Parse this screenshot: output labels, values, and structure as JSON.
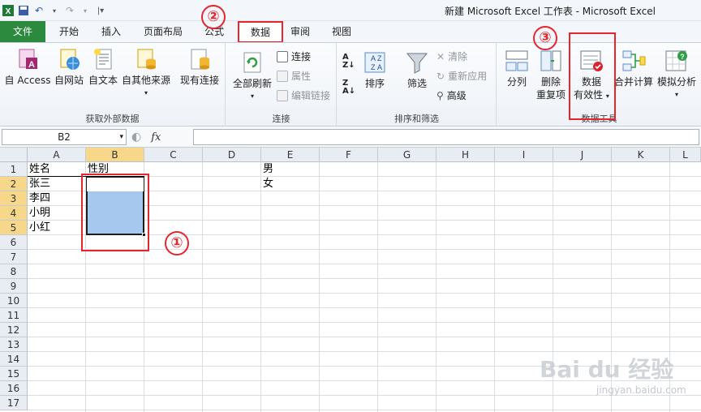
{
  "window": {
    "title": "新建 Microsoft Excel 工作表 - Microsoft Excel"
  },
  "tabs": [
    {
      "label": "文件"
    },
    {
      "label": "开始"
    },
    {
      "label": "插入"
    },
    {
      "label": "页面布局"
    },
    {
      "label": "公式"
    },
    {
      "label": "数据"
    },
    {
      "label": "审阅"
    },
    {
      "label": "视图"
    }
  ],
  "ribbon": {
    "external": {
      "label": "获取外部数据",
      "access": "自 Access",
      "web": "自网站",
      "text": "自文本",
      "other_top": "自其他来源",
      "existing": "现有连接"
    },
    "connections": {
      "label": "连接",
      "refresh_all": "全部刷新",
      "connections": "连接",
      "properties": "属性",
      "edit_links": "编辑链接"
    },
    "sort_filter": {
      "label": "排序和筛选",
      "sort": "排序",
      "filter": "筛选",
      "clear": "清除",
      "reapply": "重新应用",
      "advanced": "高级"
    },
    "data_tools": {
      "label": "数据工具",
      "text_to_columns": "分列",
      "remove_dup_top": "删除",
      "remove_dup_bottom": "重复项",
      "validation_top": "数据",
      "validation_bottom": "有效性",
      "consolidate": "合并计算",
      "whatif": "模拟分析"
    }
  },
  "formula_bar": {
    "name_box": "B2",
    "fx_label": "fx",
    "formula": ""
  },
  "grid": {
    "columns": [
      "A",
      "B",
      "C",
      "D",
      "E",
      "F",
      "G",
      "H",
      "I",
      "J",
      "K",
      "L"
    ],
    "rows": [
      "1",
      "2",
      "3",
      "4",
      "5",
      "6",
      "7",
      "8",
      "9",
      "10",
      "11",
      "12",
      "13",
      "14",
      "15",
      "16",
      "17"
    ],
    "cells": {
      "A1": "姓名",
      "B1": "性别",
      "A2": "张三",
      "A3": "李四",
      "A4": "小明",
      "A5": "小红",
      "E1": "男",
      "E2": "女"
    }
  },
  "annotations": {
    "step1": "①",
    "step2": "②",
    "step3": "③"
  },
  "watermark": {
    "brand": "Bai du 经验",
    "url": "jingyan.baidu.com"
  },
  "colors": {
    "accent_red": "#e5262c",
    "file_tab": "#2b8a3e",
    "selection": "#a6c8ee"
  }
}
